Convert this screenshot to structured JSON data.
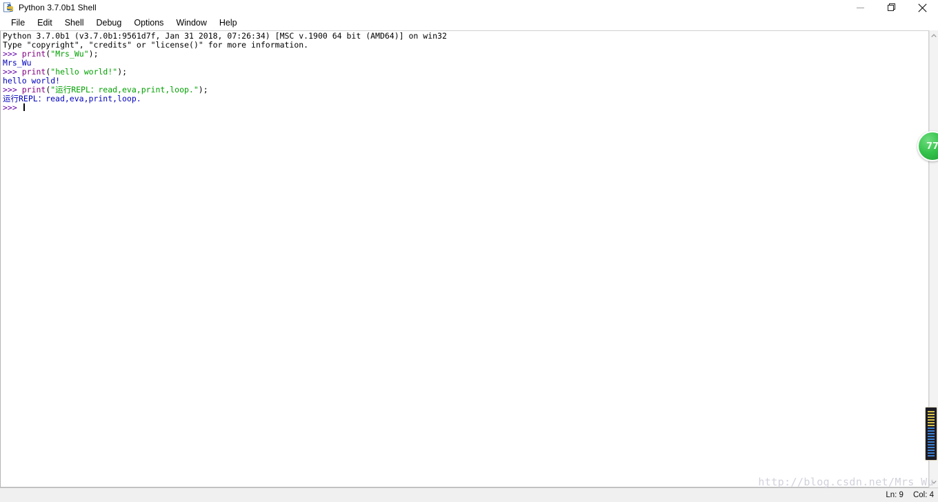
{
  "window": {
    "title": "Python 3.7.0b1 Shell",
    "icon": "python-idle-icon",
    "controls": {
      "minimize": "minimize",
      "restore": "restore",
      "close": "close"
    }
  },
  "menubar": {
    "items": [
      {
        "label": "File"
      },
      {
        "label": "Edit"
      },
      {
        "label": "Shell"
      },
      {
        "label": "Debug"
      },
      {
        "label": "Options"
      },
      {
        "label": "Window"
      },
      {
        "label": "Help"
      }
    ]
  },
  "console": {
    "lines": [
      {
        "id": "banner-version",
        "segments": [
          {
            "text": "Python 3.7.0b1 (v3.7.0b1:9561d7f, Jan 31 2018, 07:26:34) [MSC v.1900 64 bit (AMD64)] on win32",
            "color": "#000000",
            "kind": "plain"
          }
        ]
      },
      {
        "id": "banner-help",
        "segments": [
          {
            "text": "Type \"copyright\", \"credits\" or \"license()\" for more information.",
            "color": "#000000",
            "kind": "plain"
          }
        ]
      },
      {
        "id": "input-1",
        "segments": [
          {
            "text": ">>> ",
            "color": "#6200aa",
            "kind": "prompt"
          },
          {
            "text": "print",
            "color": "#800080",
            "kind": "keyword"
          },
          {
            "text": "(",
            "color": "#000000",
            "kind": "plain"
          },
          {
            "text": "\"Mrs_Wu\"",
            "color": "#00a000",
            "kind": "string"
          },
          {
            "text": ");",
            "color": "#000000",
            "kind": "plain"
          }
        ]
      },
      {
        "id": "output-1",
        "segments": [
          {
            "text": "Mrs_Wu",
            "color": "#0000bb",
            "kind": "output"
          }
        ]
      },
      {
        "id": "input-2",
        "segments": [
          {
            "text": ">>> ",
            "color": "#6200aa",
            "kind": "prompt"
          },
          {
            "text": "print",
            "color": "#800080",
            "kind": "keyword"
          },
          {
            "text": "(",
            "color": "#000000",
            "kind": "plain"
          },
          {
            "text": "\"hello world!\"",
            "color": "#00a000",
            "kind": "string"
          },
          {
            "text": ");",
            "color": "#000000",
            "kind": "plain"
          }
        ]
      },
      {
        "id": "output-2",
        "segments": [
          {
            "text": "hello world!",
            "color": "#0000bb",
            "kind": "output"
          }
        ]
      },
      {
        "id": "input-3",
        "segments": [
          {
            "text": ">>> ",
            "color": "#6200aa",
            "kind": "prompt"
          },
          {
            "text": "print",
            "color": "#800080",
            "kind": "keyword"
          },
          {
            "text": "(",
            "color": "#000000",
            "kind": "plain"
          },
          {
            "text": "\"运行REPL：read,eva,print,loop.\"",
            "color": "#00a000",
            "kind": "string"
          },
          {
            "text": ");",
            "color": "#000000",
            "kind": "plain"
          }
        ]
      },
      {
        "id": "output-3",
        "segments": [
          {
            "text": "运行REPL：read,eva,print,loop.",
            "color": "#0000bb",
            "kind": "output"
          }
        ]
      },
      {
        "id": "input-4",
        "segments": [
          {
            "text": ">>> ",
            "color": "#6200aa",
            "kind": "prompt"
          }
        ],
        "caret": true
      }
    ]
  },
  "scrollbar": {
    "up_arrow": "chevron-up-icon",
    "down_arrow": "chevron-down-icon"
  },
  "statusbar": {
    "line_label": "Ln: 9",
    "col_label": "Col: 4"
  },
  "watermark": {
    "text": "http://blog.csdn.net/Mrs_Wu"
  },
  "float_badge": {
    "label": "77"
  },
  "colors": {
    "prompt": "#6200aa",
    "keyword": "#800080",
    "string": "#00a000",
    "output": "#0000bb",
    "plain": "#000000",
    "window_bg": "#ffffff",
    "statusbar_bg": "#f0f0f0",
    "badge_green": "#34c24b"
  }
}
